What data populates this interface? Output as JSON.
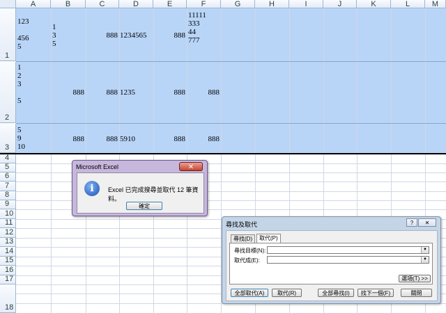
{
  "spreadsheet": {
    "columns": [
      "A",
      "B",
      "C",
      "D",
      "E",
      "F",
      "G",
      "H",
      "I",
      "J",
      "K",
      "L",
      "M"
    ],
    "row_numbers": [
      "1",
      "2",
      "3",
      "4",
      "5",
      "6",
      "7",
      "8",
      "9",
      "10",
      "11",
      "12",
      "13",
      "14",
      "15",
      "16",
      "17",
      "18"
    ],
    "cells": {
      "A1": "123\n\n456\n5",
      "B1": "1\n3\n5",
      "C1": "888",
      "D1": "1234565",
      "E1": "888",
      "F1": "11111\n333\n44\n777",
      "A2": "1\n2\n3\n\n5",
      "B2": "888",
      "C2": "888",
      "D2": "1235",
      "E2": "888",
      "F2": "888",
      "A3": "5\n9\n10",
      "B3": "888",
      "C3": "888",
      "D3": "5910",
      "E3": "888",
      "F3": "888"
    }
  },
  "message_box": {
    "title": "Microsoft Excel",
    "close_symbol": "✕",
    "icon": "info-icon",
    "message": "Excel 已完成搜尋並取代 12 筆資料。",
    "ok_label": "確定"
  },
  "find_replace": {
    "title": "尋找及取代",
    "help_symbol": "?",
    "close_symbol": "✕",
    "tabs": [
      "尋找(D)",
      "取代(P)"
    ],
    "find_label": "尋找目標(N):",
    "replace_label": "取代成(E):",
    "find_value": "",
    "replace_value": "",
    "options_label": "選項(T) >>",
    "buttons": {
      "replace_all": "全部取代(A)",
      "replace": "取代(R)",
      "find_all": "全部尋找(I)",
      "find_next": "找下一個(F)",
      "close": "關閉"
    }
  },
  "colors": {
    "selection": "#b8d5f8",
    "header_bg": "#e4ecf7",
    "grid": "#d0d7e5"
  }
}
